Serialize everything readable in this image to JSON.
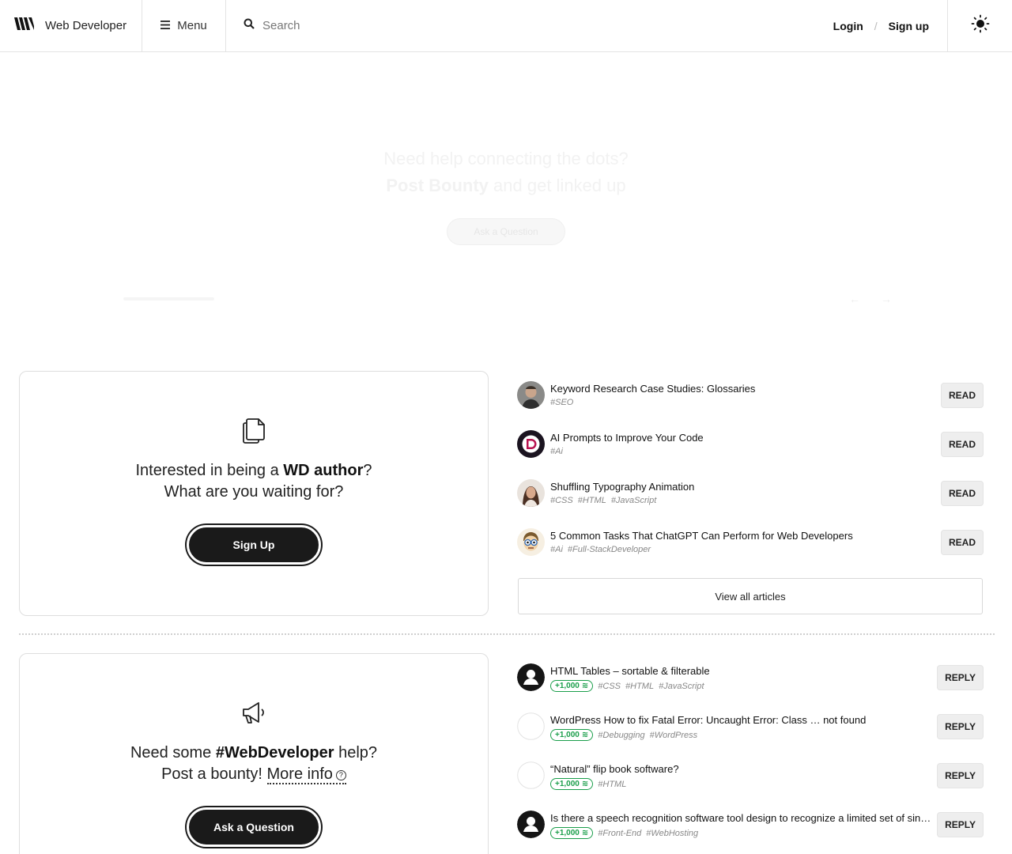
{
  "header": {
    "brand": "Web Developer",
    "menu_label": "Menu",
    "search_placeholder": "Search",
    "login": "Login",
    "separator": "/",
    "signup": "Sign up"
  },
  "hero": {
    "line1": "Need help connecting the dots?",
    "line2_bold": "Post Bounty",
    "line2_rest": " and get linked up",
    "button": "Ask a Question"
  },
  "author_card": {
    "text_pre": "Interested in being a ",
    "text_bold": "WD author",
    "text_post": "?",
    "line2": "What are you waiting for?",
    "button": "Sign Up"
  },
  "articles": [
    {
      "title": "Keyword Research Case Studies: Glossaries",
      "tags": [
        "#SEO"
      ],
      "action": "READ"
    },
    {
      "title": "AI Prompts to Improve Your Code",
      "tags": [
        "#Ai"
      ],
      "action": "READ"
    },
    {
      "title": "Shuffling Typography Animation",
      "tags": [
        "#CSS",
        "#HTML",
        "#JavaScript"
      ],
      "action": "READ"
    },
    {
      "title": "5 Common Tasks That ChatGPT Can Perform for Web Developers",
      "tags": [
        "#Ai",
        "#Full-StackDeveloper"
      ],
      "action": "READ"
    }
  ],
  "view_all": "View all articles",
  "help_card": {
    "text_pre": "Need some ",
    "text_bold": "#WebDeveloper",
    "text_post": " help?",
    "line2_pre": "Post a bounty! ",
    "more_info": "More info",
    "help_glyph": "?",
    "button": "Ask a Question"
  },
  "questions": [
    {
      "title": "HTML Tables – sortable & filterable",
      "bounty": "+1,000",
      "tags": [
        "#CSS",
        "#HTML",
        "#JavaScript"
      ],
      "action": "REPLY"
    },
    {
      "title": "WordPress How to fix Fatal Error: Uncaught Error: Class … not found",
      "bounty": "+1,000",
      "tags": [
        "#Debugging",
        "#WordPress"
      ],
      "action": "REPLY"
    },
    {
      "title": "“Natural” flip book software?",
      "bounty": "+1,000",
      "tags": [
        "#HTML"
      ],
      "action": "REPLY"
    },
    {
      "title": "Is there a speech recognition software tool design to recognize a limited set of single words?",
      "bounty": "+1,000",
      "tags": [
        "#Front-End",
        "#WebHosting"
      ],
      "action": "REPLY"
    }
  ],
  "colors": {
    "accent_green": "#1a9e4a",
    "button_dark": "#1a1a1a"
  }
}
